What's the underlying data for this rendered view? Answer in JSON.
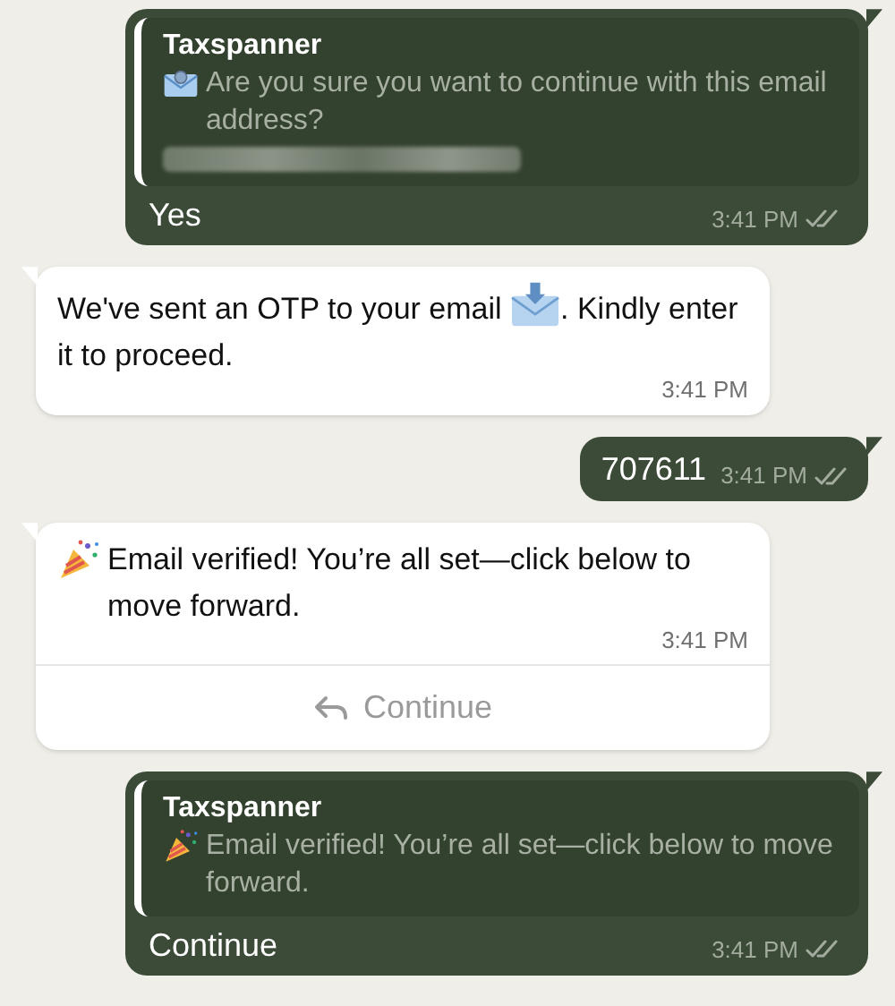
{
  "messages": [
    {
      "kind": "outgoing",
      "quote": {
        "author": "Taxspanner",
        "text": "Are you sure you want to continue with this email address?",
        "redacted": true
      },
      "text": "Yes",
      "time": "3:41 PM"
    },
    {
      "kind": "incoming",
      "text": "We've sent an OTP to your email . Kindly enter it to proceed.",
      "time": "3:41 PM"
    },
    {
      "kind": "outgoing",
      "text": "707611",
      "time": "3:41 PM"
    },
    {
      "kind": "incoming",
      "text": "Email verified! You’re all set—click below to move forward.",
      "time": "3:41 PM",
      "button": {
        "label": "Continue"
      }
    },
    {
      "kind": "outgoing",
      "quote": {
        "author": "Taxspanner",
        "text": "Email verified! You’re all set—click below to move forward."
      },
      "text": "Continue",
      "time": "3:41 PM"
    }
  ]
}
